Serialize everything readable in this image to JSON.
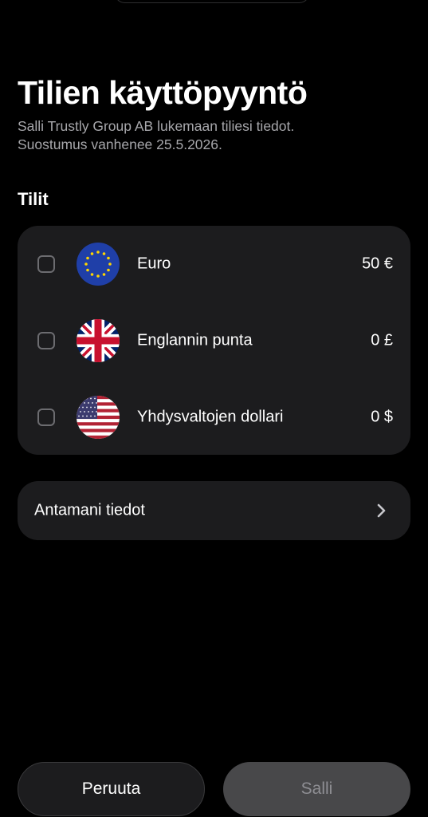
{
  "header": {
    "title": "Tilien käyttöpyyntö",
    "subtitle_line1": "Salli Trustly Group AB lukemaan tiliesi tiedot.",
    "subtitle_line2": "Suostumus vanhenee 25.5.2026."
  },
  "accounts": {
    "label": "Tilit",
    "items": [
      {
        "name": "Euro",
        "balance": "50 €",
        "flag": "eu-flag-icon",
        "checked": false
      },
      {
        "name": "Englannin punta",
        "balance": "0 £",
        "flag": "uk-flag-icon",
        "checked": false
      },
      {
        "name": "Yhdysvaltojen dollari",
        "balance": "0 $",
        "flag": "us-flag-icon",
        "checked": false
      }
    ]
  },
  "details": {
    "label": "Antamani tiedot",
    "icon": "chevron-right-icon"
  },
  "footer": {
    "cancel_label": "Peruuta",
    "allow_label": "Salli"
  },
  "colors": {
    "background": "#000000",
    "card": "#1c1c1e",
    "disabled_button": "#48484a",
    "subtle_text": "#a7a7ab"
  }
}
